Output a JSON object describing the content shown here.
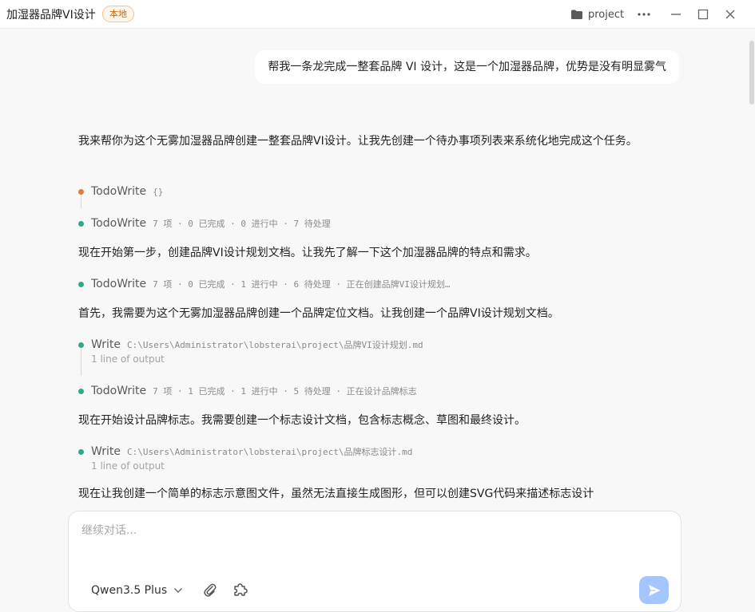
{
  "window": {
    "title": "加湿器品牌VI设计",
    "badge": "本地",
    "project_label": "project",
    "folder_icon": "folder-icon",
    "more_icon": "more-horizontal-icon",
    "minimize_icon": "minimize-icon",
    "maximize_icon": "maximize-icon",
    "close_icon": "close-icon"
  },
  "conversation": {
    "user_message": "帮我一条龙完成一整套品牌 VI 设计，这是一个加湿器品牌，优势是没有明显雾气",
    "para_1": "我来帮你为这个无雾加湿器品牌创建一整套品牌VI设计。让我先创建一个待办事项列表来系统化地完成这个任务。",
    "tool_1": {
      "name": "TodoWrite",
      "detail": "{}",
      "status_color": "#e07b39"
    },
    "tool_2": {
      "name": "TodoWrite",
      "detail": "7 项 · 0 已完成 · 0 进行中 · 7 待处理",
      "status_color": "#2fa98c"
    },
    "para_2": "现在开始第一步，创建品牌VI设计规划文档。让我先了解一下这个加湿器品牌的特点和需求。",
    "tool_3": {
      "name": "TodoWrite",
      "detail": "7 项 · 0 已完成 · 1 进行中 · 6 待处理 · 正在创建品牌VI设计规划…",
      "status_color": "#2fa98c"
    },
    "para_3": "首先，我需要为这个无雾加湿器品牌创建一个品牌定位文档。让我创建一个品牌VI设计规划文档。",
    "tool_4": {
      "name": "Write",
      "detail": "C:\\Users\\Administrator\\lobsterai\\project\\品牌VI设计规划.md",
      "output": "1 line of output",
      "status_color": "#2fa98c"
    },
    "tool_5": {
      "name": "TodoWrite",
      "detail": "7 项 · 1 已完成 · 1 进行中 · 5 待处理 · 正在设计品牌标志",
      "status_color": "#2fa98c"
    },
    "para_4": "现在开始设计品牌标志。我需要创建一个标志设计文档，包含标志概念、草图和最终设计。",
    "tool_6": {
      "name": "Write",
      "detail": "C:\\Users\\Administrator\\lobsterai\\project\\品牌标志设计.md",
      "output": "1 line of output",
      "status_color": "#2fa98c"
    },
    "para_5": "现在让我创建一个简单的标志示意图文件，虽然无法直接生成图形，但可以创建SVG代码来描述标志设计"
  },
  "composer": {
    "placeholder": "继续对话...",
    "value": "",
    "model": "Qwen3.5 Plus",
    "attach_icon": "paperclip-icon",
    "plugin_icon": "puzzle-icon",
    "send_icon": "send-icon",
    "send_color": "#a5c5ff"
  }
}
